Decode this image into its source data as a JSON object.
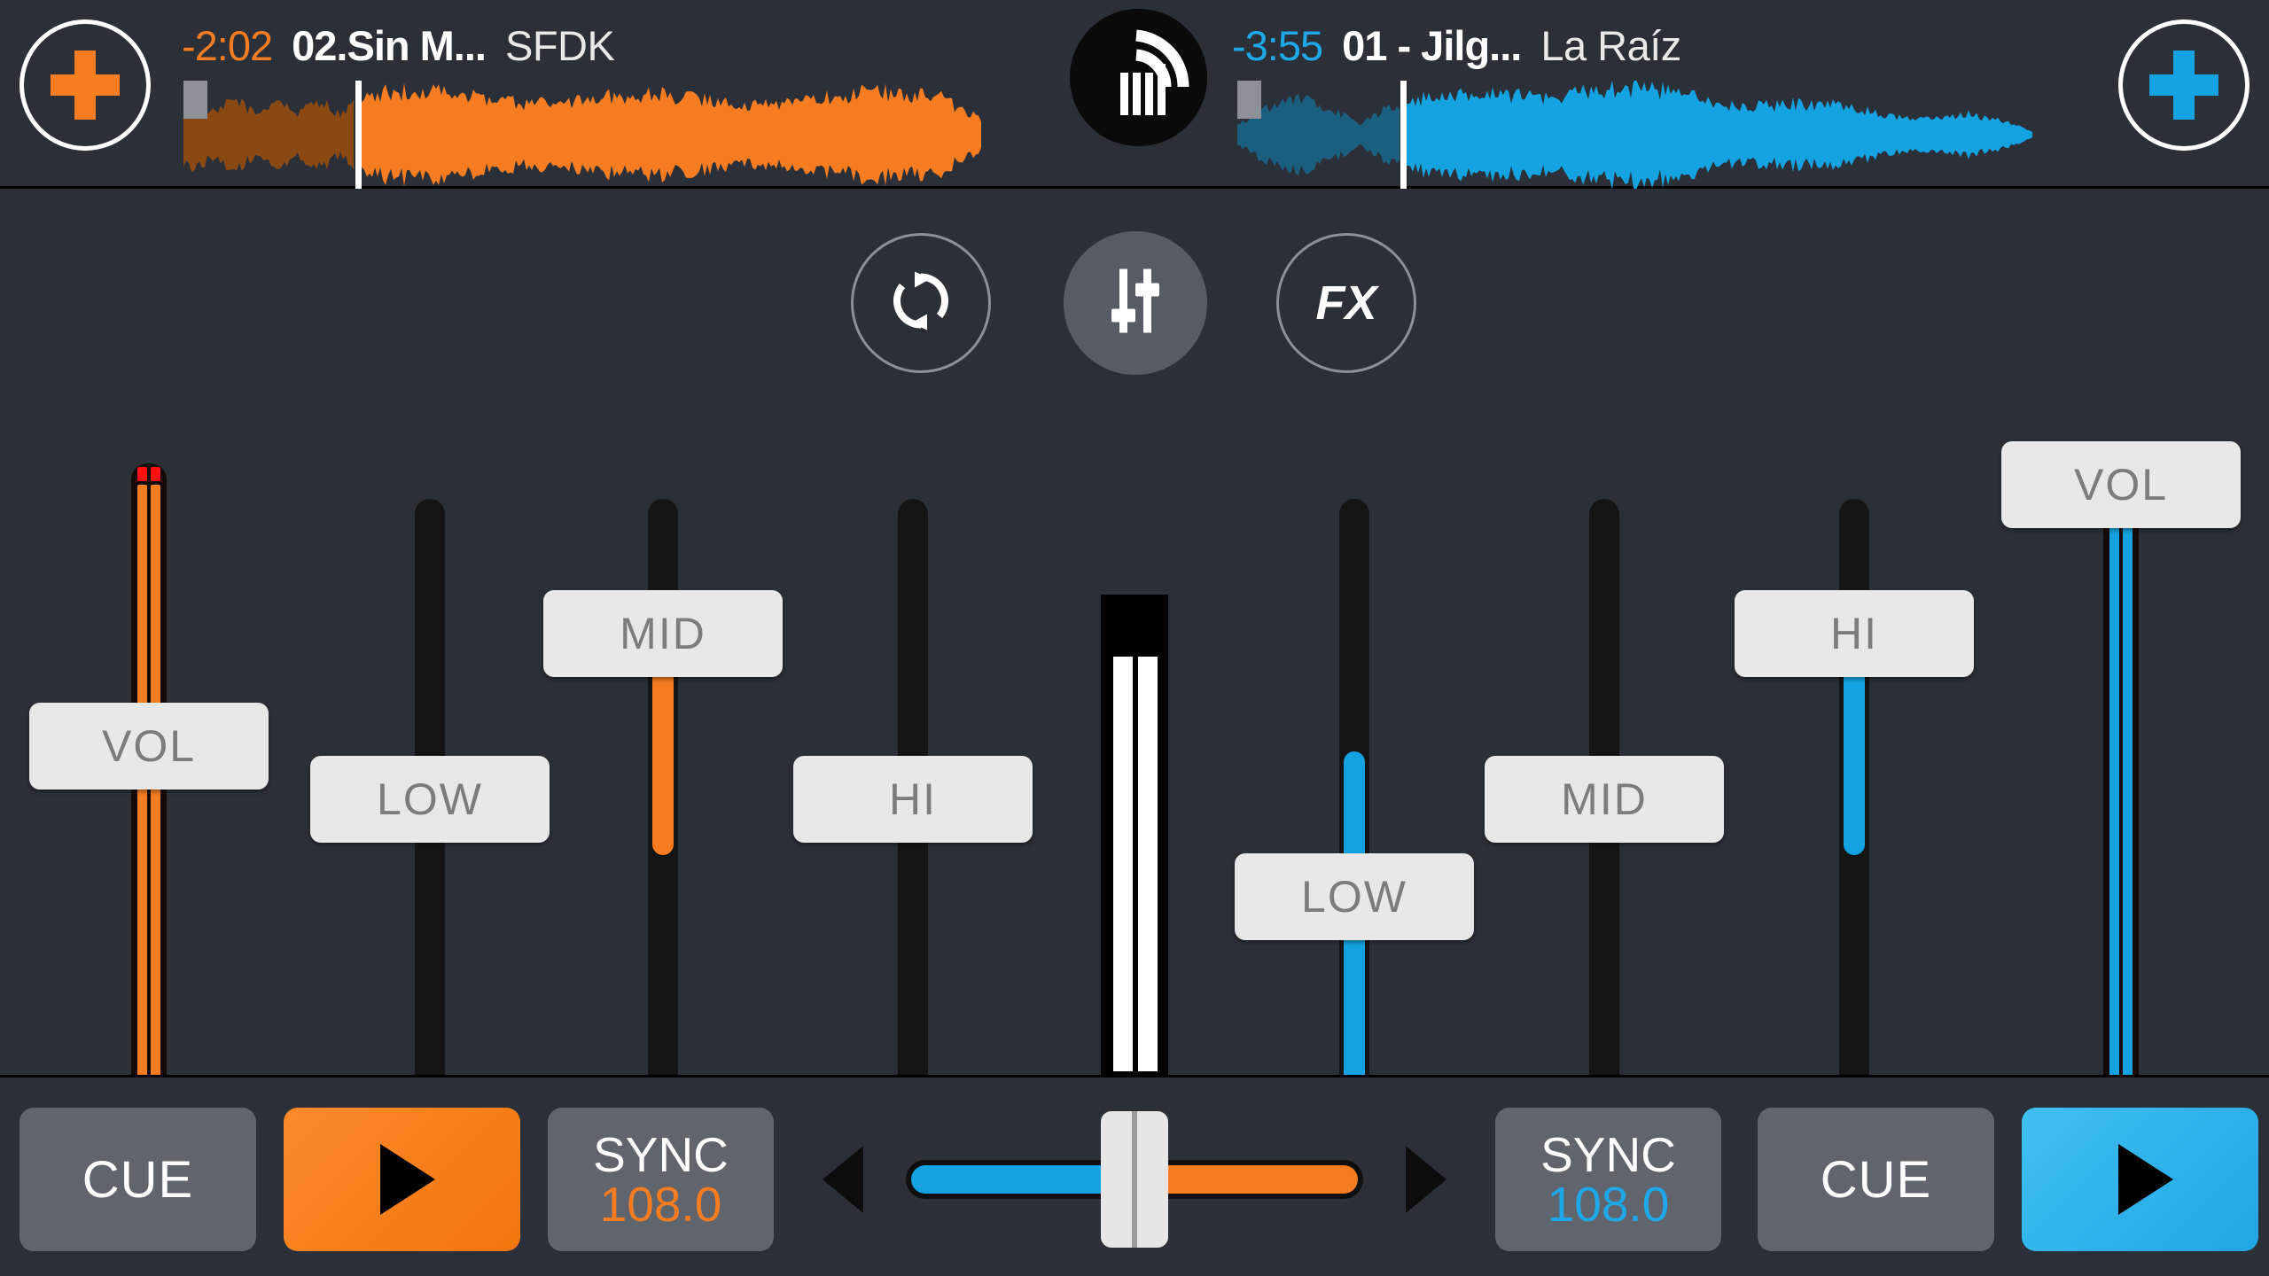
{
  "app": {
    "logo_icon": "edjing-soundwave-logo",
    "background_color": "#2b2f38",
    "deck_a_color": "#f57c20",
    "deck_b_color": "#14a3e0"
  },
  "decks": {
    "left": {
      "add_track_label": "+",
      "add_track_icon": "plus-icon",
      "remaining_time": "-2:02",
      "title": "02.Sin M...",
      "artist": "SFDK",
      "waveform_color": "#f57c20",
      "waveform_played_color": "#8a4913"
    },
    "right": {
      "add_track_label": "+",
      "add_track_icon": "plus-icon",
      "remaining_time": "-3:55",
      "title": "01 - Jilg...",
      "artist": "La Raíz",
      "waveform_color": "#14a3e0",
      "waveform_played_color": "#1a5f80"
    }
  },
  "mode_buttons": [
    {
      "name": "loop",
      "icon": "loop-sync-icon",
      "label": "",
      "active": false
    },
    {
      "name": "mixer",
      "icon": "mixer-faders-icon",
      "label": "",
      "active": true
    },
    {
      "name": "fx",
      "icon": "fx-icon",
      "label": "FX",
      "active": false
    }
  ],
  "pads_button": {
    "icon": "grid-3x3-icon",
    "label": ""
  },
  "faders": {
    "left": [
      {
        "name": "vol",
        "label": "VOL",
        "type": "vu",
        "value_pct": 62,
        "color": "#f57c20"
      },
      {
        "name": "low",
        "label": "LOW",
        "type": "eq",
        "value_pct": 48,
        "color": "#f57c20"
      },
      {
        "name": "mid",
        "label": "MID",
        "type": "eq",
        "value_pct": 99,
        "color": "#f57c20"
      },
      {
        "name": "hi",
        "label": "HI",
        "type": "eq",
        "value_pct": 50,
        "color": "#f57c20"
      }
    ],
    "right": [
      {
        "name": "low",
        "label": "LOW",
        "type": "eq",
        "value_pct": 2,
        "color": "#14a3e0"
      },
      {
        "name": "mid",
        "label": "MID",
        "type": "eq",
        "value_pct": 50,
        "color": "#14a3e0"
      },
      {
        "name": "hi",
        "label": "HI",
        "type": "eq",
        "value_pct": 99,
        "color": "#14a3e0"
      },
      {
        "name": "vol",
        "label": "VOL",
        "type": "vu",
        "value_pct": 92,
        "color": "#14a3e0"
      }
    ]
  },
  "master_meter": {
    "name": "master-level",
    "level_pct": 89
  },
  "transport": {
    "left": {
      "cue_label": "CUE",
      "play_icon": "play-icon",
      "sync_label": "SYNC",
      "bpm": "108.0",
      "playing": true
    },
    "right": {
      "cue_label": "CUE",
      "play_icon": "play-icon",
      "sync_label": "SYNC",
      "bpm": "108.0",
      "playing": true
    }
  },
  "crossfader": {
    "name": "crossfader",
    "position_pct": 50,
    "left_color": "#14a3e0",
    "right_color": "#f57c20",
    "arrow_left_icon": "triangle-left-icon",
    "arrow_right_icon": "triangle-right-icon"
  }
}
